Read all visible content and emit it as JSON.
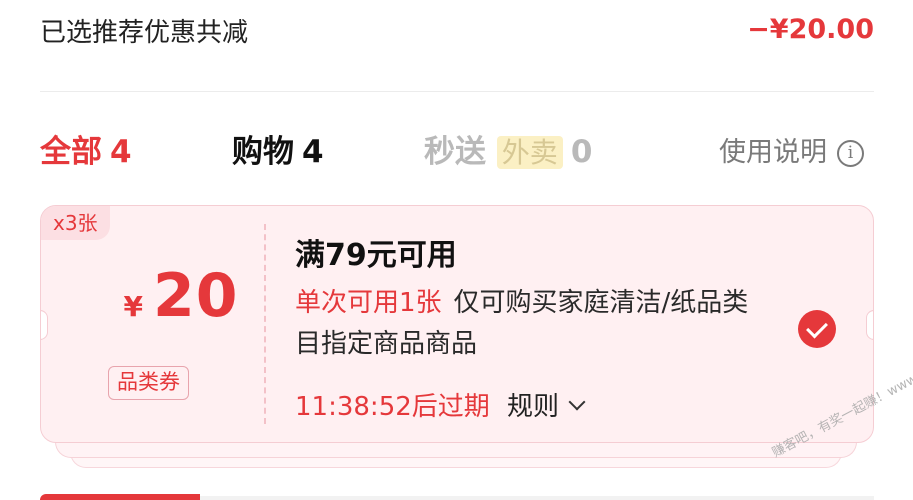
{
  "summary": {
    "label": "已选推荐优惠共减",
    "amount": "−¥20.00"
  },
  "tabs": [
    {
      "label": "全部",
      "count": "4"
    },
    {
      "label": "购物",
      "count": "4"
    },
    {
      "label": "秒送",
      "badge": "外卖",
      "count": "0"
    }
  ],
  "help": {
    "label": "使用说明",
    "icon": "info-icon"
  },
  "coupon": {
    "quantity": "x3张",
    "currency": "¥",
    "value": "20",
    "type": "品类券",
    "title": "满79元可用",
    "limit": "单次可用1张",
    "scope": "仅可购买家庭清洁/纸品类目指定商品商品",
    "expiry": "11:38:52后过期",
    "rules_label": "规则",
    "selected": true
  },
  "watermark": "赚客吧，有奖一起赚！www.zuanke8.com",
  "colors": {
    "accent": "#e5383b",
    "coupon_bg": "#fff0f2",
    "takeout_bg": "#fbf0c4"
  }
}
